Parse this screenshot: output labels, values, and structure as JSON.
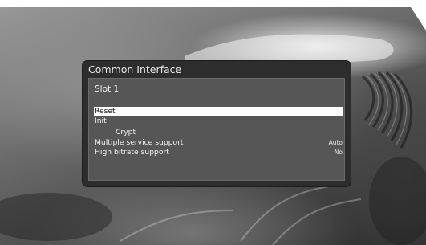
{
  "dialog": {
    "title": "Common Interface",
    "slot_label": "Slot 1",
    "menu_items": [
      {
        "label": "Reset",
        "value": ""
      },
      {
        "label": "Init",
        "value": ""
      },
      {
        "label": "Crypt",
        "value": ""
      },
      {
        "label": "Multiple service support",
        "value": "Auto"
      },
      {
        "label": "High bitrate support",
        "value": "No"
      }
    ],
    "selected_index": 0
  },
  "colors": {
    "panel_bg": "#2d2d2d",
    "inner_bg": "#565656",
    "highlight": "#ffffff"
  }
}
